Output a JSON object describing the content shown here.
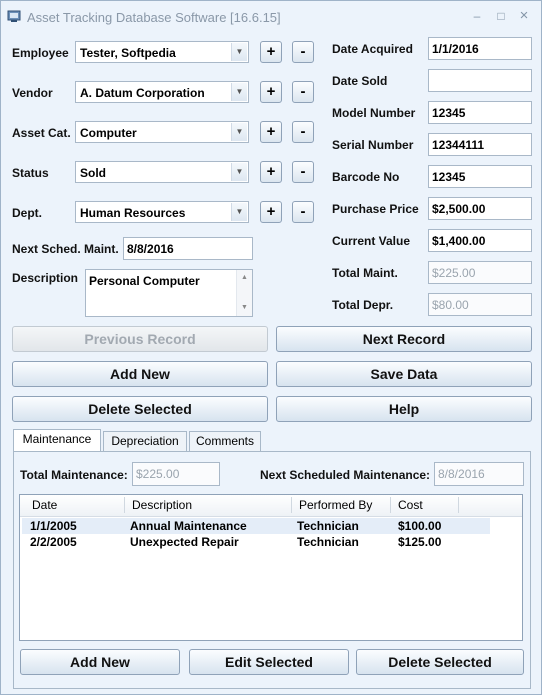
{
  "window": {
    "title": "Asset Tracking Database Software [16.6.15]",
    "minimize": "–",
    "maximize": "□",
    "close": "×"
  },
  "colors": {
    "accent": "#ecf3fb",
    "border": "#8fa2b8",
    "disabled_text": "#9aa4ae"
  },
  "left": {
    "employee": {
      "label": "Employee",
      "value": "Tester, Softpedia"
    },
    "vendor": {
      "label": "Vendor",
      "value": "A. Datum Corporation"
    },
    "asset_cat": {
      "label": "Asset Cat.",
      "value": "Computer"
    },
    "status": {
      "label": "Status",
      "value": "Sold"
    },
    "dept": {
      "label": "Dept.",
      "value": "Human Resources"
    },
    "plus": "+",
    "minus": "-",
    "next_maint": {
      "label": "Next Sched. Maint.",
      "value": "8/8/2016"
    },
    "description": {
      "label": "Description",
      "value": "Personal Computer"
    }
  },
  "right": {
    "date_acquired": {
      "label": "Date Acquired",
      "value": "1/1/2016"
    },
    "date_sold": {
      "label": "Date Sold",
      "value": ""
    },
    "model_number": {
      "label": "Model Number",
      "value": "12345"
    },
    "serial_number": {
      "label": "Serial Number",
      "value": "12344111"
    },
    "barcode_no": {
      "label": "Barcode No",
      "value": "12345"
    },
    "purchase_price": {
      "label": "Purchase Price",
      "value": "$2,500.00"
    },
    "current_value": {
      "label": "Current Value",
      "value": "$1,400.00"
    },
    "total_maint": {
      "label": "Total Maint.",
      "value": "$225.00"
    },
    "total_depr": {
      "label": "Total Depr.",
      "value": "$80.00"
    }
  },
  "buttons": {
    "previous": "Previous Record",
    "next": "Next Record",
    "add_new": "Add New",
    "save": "Save Data",
    "delete": "Delete Selected",
    "help": "Help"
  },
  "tabs": [
    {
      "label": "Maintenance"
    },
    {
      "label": "Depreciation"
    },
    {
      "label": "Comments"
    }
  ],
  "maintenance": {
    "total_label": "Total Maintenance:",
    "total_value": "$225.00",
    "next_label": "Next Scheduled Maintenance:",
    "next_value": "8/8/2016",
    "columns": [
      "Date",
      "Description",
      "Performed By",
      "Cost"
    ],
    "rows": [
      {
        "date": "1/1/2005",
        "description": "Annual Maintenance",
        "performed_by": "Technician",
        "cost": "$100.00"
      },
      {
        "date": "2/2/2005",
        "description": "Unexpected Repair",
        "performed_by": "Technician",
        "cost": "$125.00"
      }
    ],
    "add_new": "Add New",
    "edit": "Edit Selected",
    "delete": "Delete Selected"
  }
}
